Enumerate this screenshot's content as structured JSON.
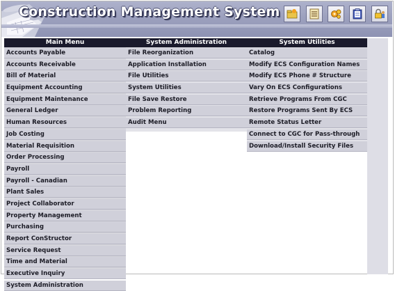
{
  "app": {
    "title": "Construction Management System"
  },
  "toolbar": {
    "icons": [
      "folder-sun-icon",
      "document-list-icon",
      "gears-icon",
      "clipboard-icon",
      "lock-users-icon"
    ]
  },
  "main_menu": {
    "header": "Main Menu",
    "items": [
      "Accounts Payable",
      "Accounts Receivable",
      "Bill of Material",
      "Equipment Accounting",
      "Equipment Maintenance",
      "General Ledger",
      "Human Resources",
      "Job Costing",
      "Material Requisition",
      "Order Processing",
      "Payroll",
      "Payroll - Canadian",
      "Plant Sales",
      "Project Collaborator",
      "Property Management",
      "Purchasing",
      "Report ConStructor",
      "Service Request",
      "Time and Material",
      "Executive Inquiry",
      "System Administration"
    ]
  },
  "system_administration": {
    "header": "System Administration",
    "items": [
      "File Reorganization",
      "Application Installation",
      "File Utilities",
      "System Utilities",
      "File Save Restore",
      "Problem Reporting",
      "Audit Menu"
    ]
  },
  "system_utilities": {
    "header": "System Utilities",
    "items": [
      "Catalog",
      "Modify ECS Configuration Names",
      "Modify ECS Phone # Structure",
      "Vary On ECS Configurations",
      "Retrieve Programs From CGC",
      "Restore Programs Sent By ECS",
      "Remote Status Letter",
      "Connect to CGC for Pass-through",
      "Download/Install Security Files"
    ]
  },
  "colors": {
    "banner": "#9ea2bf",
    "column_header": "#1a1a2c",
    "menu_item": "#d0d0da",
    "title_text": "#ffffff"
  }
}
